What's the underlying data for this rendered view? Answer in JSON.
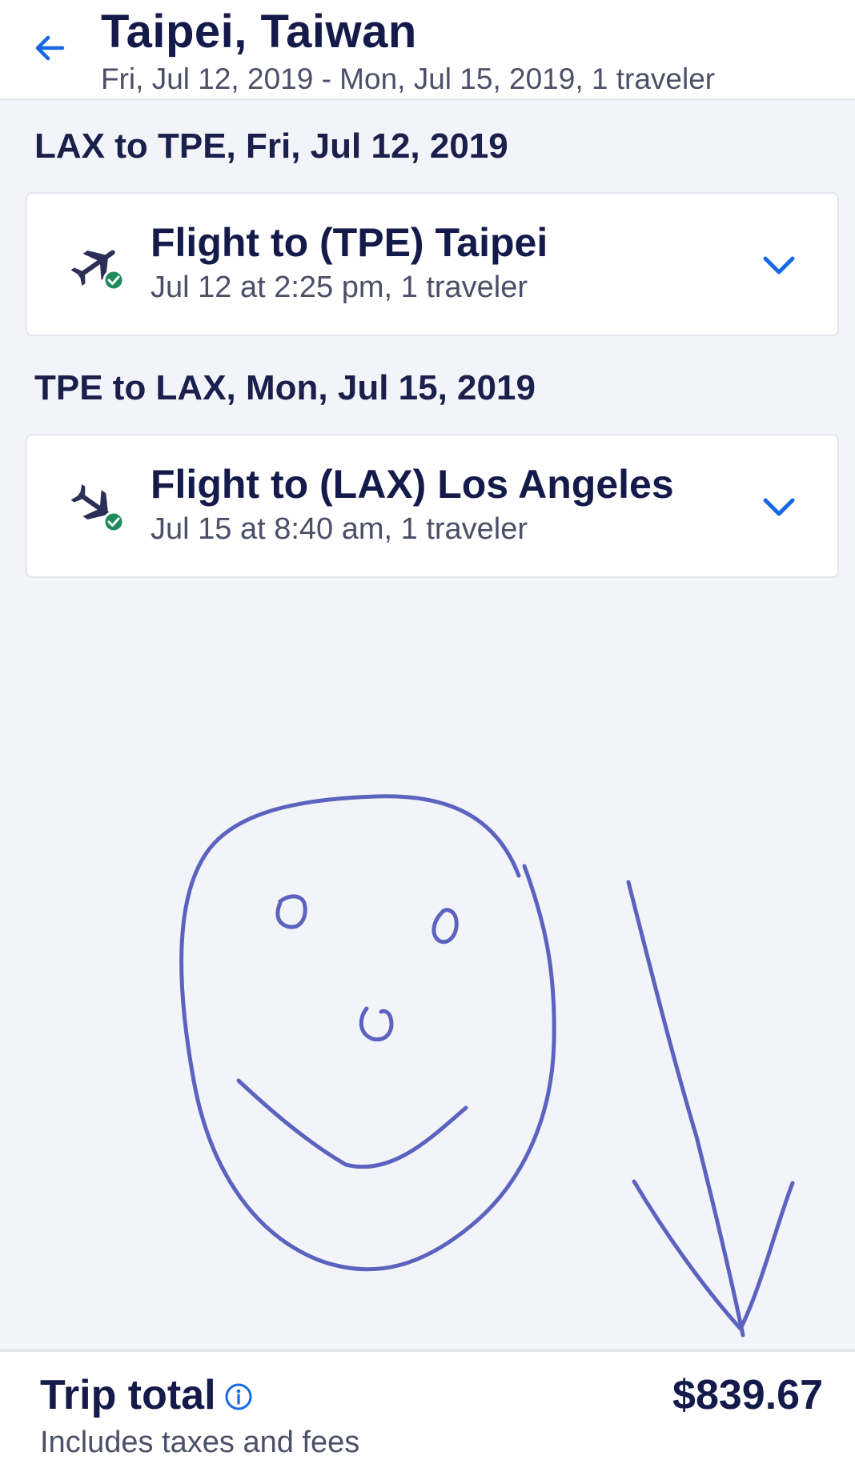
{
  "header": {
    "back_icon": "arrow-left-icon",
    "title": "Taipei, Taiwan",
    "subtitle": "Fri, Jul 12, 2019 - Mon, Jul 15, 2019, 1 traveler"
  },
  "legs": [
    {
      "heading": "LAX to TPE, Fri, Jul 12, 2019",
      "title": "Flight to (TPE) Taipei",
      "subtitle": "Jul 12 at 2:25 pm, 1 traveler",
      "icon": "plane-check-icon"
    },
    {
      "heading": "TPE to LAX, Mon, Jul 15, 2019",
      "title": "Flight to (LAX) Los Angeles",
      "subtitle": "Jul 15 at 8:40 am, 1 traveler",
      "icon": "plane-check-icon"
    }
  ],
  "footer": {
    "label": "Trip total",
    "subtext": "Includes taxes and fees",
    "price": "$839.67",
    "info_icon": "info-icon"
  },
  "colors": {
    "accent": "#1668e3",
    "text_dark": "#141a4a",
    "text_muted": "#4b5068",
    "background": "#f3f4f9",
    "check_green": "#1f8a5c",
    "drawing_ink": "#5b63bf"
  }
}
